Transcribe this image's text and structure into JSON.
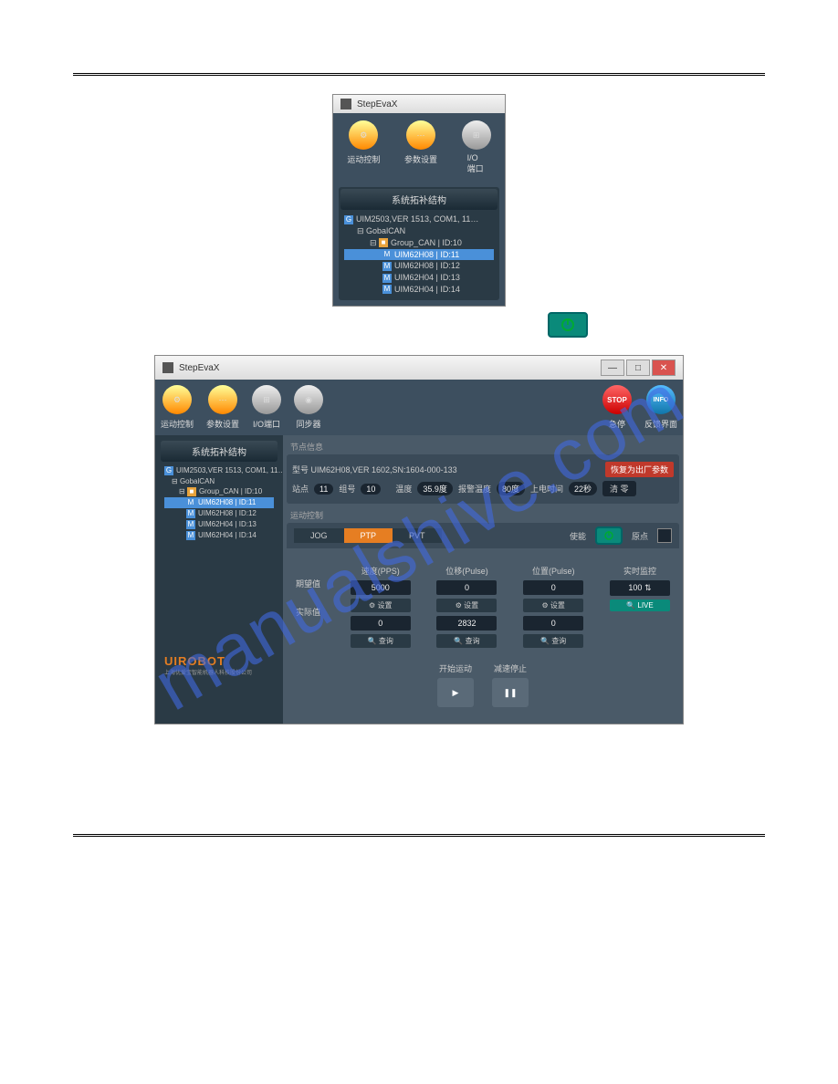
{
  "app_title": "StepEvaX",
  "toolbar": {
    "motion": "运动控制",
    "params": "参数设置",
    "io": "I/O端口",
    "sync": "同步器",
    "estop": "急停",
    "feedback": "反馈界面"
  },
  "tree": {
    "title": "系统拓补结构",
    "root": "UIM2503,VER 1513, COM1, 11…",
    "gobal": "GobalCAN",
    "group": "Group_CAN | ID:10",
    "nodes": [
      "UIM62H08 | ID:11",
      "UIM62H08 | ID:12",
      "UIM62H04 | ID:13",
      "UIM62H04 | ID:14"
    ]
  },
  "tree2_root": "UIM2503,VER 1513, COM1, 11…",
  "node_info": {
    "header": "节点信息",
    "model": "型号 UIM62H08,VER 1602,SN:1604-000-133",
    "restore": "恢复为出厂参数",
    "station_label": "站点",
    "station": "11",
    "group_label": "组号",
    "group": "10",
    "temp_label": "温度",
    "temp": "35.9度",
    "alarm_label": "报警温度",
    "alarm": "80度",
    "uptime_label": "上电时间",
    "uptime": "22秒",
    "clear": "清 零"
  },
  "motion": {
    "header": "运动控制",
    "tabs": {
      "jog": "JOG",
      "ptp": "PTP",
      "pvt": "PVT"
    },
    "enable": "使能",
    "origin": "原点",
    "cols": {
      "speed": "速度(PPS)",
      "disp": "位移(Pulse)",
      "pos": "位置(Pulse)",
      "monitor": "实时监控"
    },
    "row_expect": "期望值",
    "row_actual": "实际值",
    "vals": {
      "speed_exp": "5000",
      "disp_exp": "0",
      "pos_exp": "0",
      "mon": "100",
      "speed_act": "0",
      "disp_act": "2832",
      "pos_act": "0"
    },
    "set_btn": "⚙ 设置",
    "query_btn": "🔍 查询",
    "live_btn": "🔍 LIVE",
    "start": "开始运动",
    "stop": "减速停止"
  },
  "logo": {
    "name": "UIROBOT",
    "sub": "上海优爱宝智能机器人科技股份公司"
  }
}
